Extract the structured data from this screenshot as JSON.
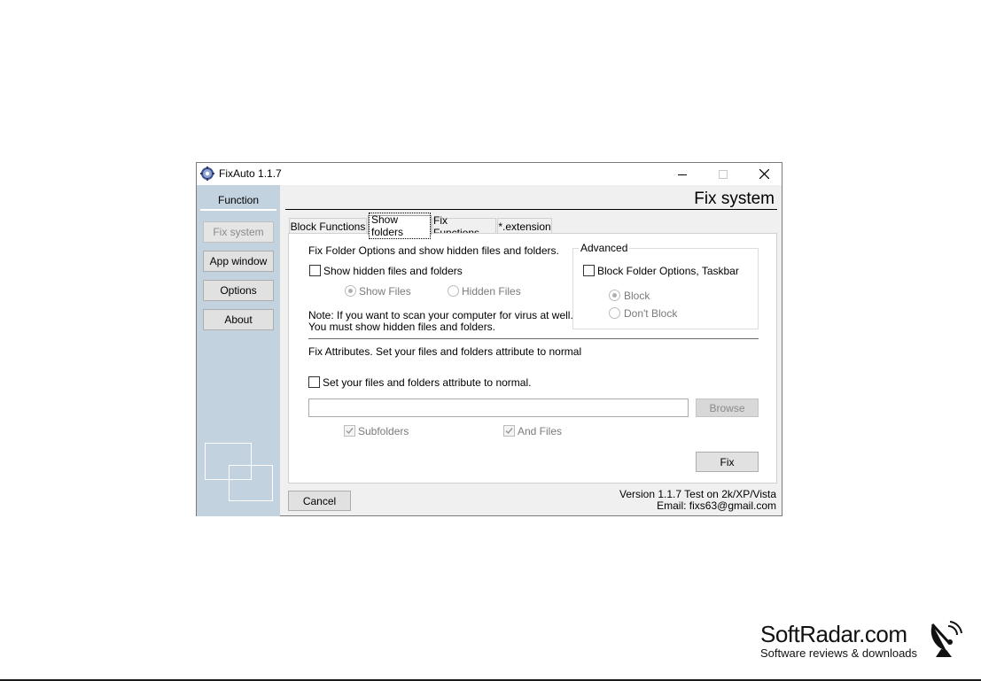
{
  "window": {
    "title": "FixAuto 1.1.7",
    "controls": {
      "minimize": "minimize-icon",
      "maximize": "maximize-icon",
      "close": "close-icon"
    }
  },
  "sidebar": {
    "header": "Function",
    "items": [
      {
        "label": "Fix system",
        "enabled": false
      },
      {
        "label": "App window",
        "enabled": true
      },
      {
        "label": "Options",
        "enabled": true
      },
      {
        "label": "About",
        "enabled": true
      }
    ],
    "background_color": "#c3d2df"
  },
  "content": {
    "title": "Fix system",
    "tabs": [
      {
        "label": "Block Functions",
        "active": false
      },
      {
        "label": "Show folders",
        "active": true
      },
      {
        "label": "Fix Functions",
        "active": false
      },
      {
        "label": "*.extension",
        "active": false
      }
    ]
  },
  "show_folders": {
    "intro": "Fix Folder Options and show hidden files and folders.",
    "show_hidden_checkbox": {
      "label": "Show hidden files and folders",
      "checked": false
    },
    "radio_show_files": {
      "label": "Show Files",
      "selected": true,
      "enabled": false
    },
    "radio_hidden_files": {
      "label": "Hidden Files",
      "selected": false,
      "enabled": false
    },
    "note_line1": "Note: If you want to scan your computer for virus at well.",
    "note_line2": "You must show hidden files and folders.",
    "advanced": {
      "title": "Advanced",
      "block_checkbox": {
        "label": "Block Folder Options, Taskbar",
        "checked": false
      },
      "radio_block": {
        "label": "Block",
        "selected": true,
        "enabled": false
      },
      "radio_dont_block": {
        "label": "Don't Block",
        "selected": false,
        "enabled": false
      }
    },
    "attributes_heading": "Fix Attributes. Set your files and folders attribute to normal",
    "attributes_checkbox": {
      "label": "Set your files and folders attribute to normal.",
      "checked": false
    },
    "path_value": "",
    "browse_label": "Browse",
    "subfolders": {
      "label": "Subfolders",
      "checked": true,
      "enabled": false
    },
    "and_files": {
      "label": "And Files",
      "checked": true,
      "enabled": false
    },
    "fix_label": "Fix"
  },
  "footer": {
    "cancel_label": "Cancel",
    "version_text": "Version 1.1.7 Test on 2k/XP/Vista",
    "email_text": "Email: fixs63@gmail.com"
  },
  "watermark": {
    "name": "SoftRadar.com",
    "tagline": "Software reviews & downloads",
    "icon": "satellite-dish-icon"
  }
}
